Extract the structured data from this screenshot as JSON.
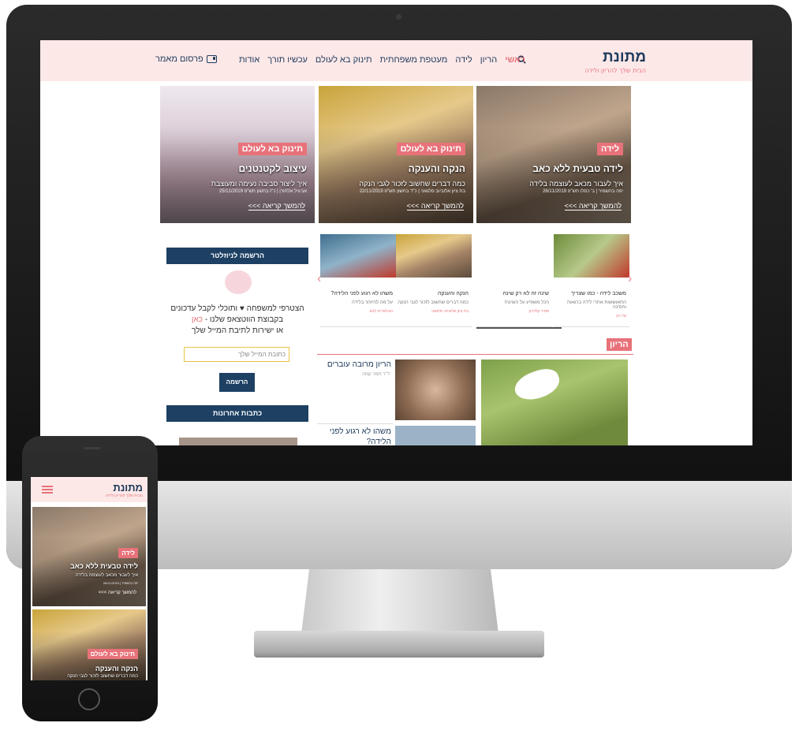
{
  "site": {
    "logo": "מתונת",
    "tagline": "הבית שלך להריון ולידה"
  },
  "nav": {
    "items": [
      "ראשי",
      "הריון",
      "לידה",
      "מעטפת משפחתית",
      "תינוק בא לעולם",
      "עכשיו תורך",
      "אודות"
    ],
    "publish": "פרסום מאמר"
  },
  "hero": [
    {
      "tag": "לידה",
      "title": "לידה טבעית ללא כאב",
      "subtitle": "איך לעבור מכאב לעוצמה בלידה",
      "meta": "יפה בהשמיר | ב' כסלו תש\"פ 26/11/2019",
      "more": "להמשך קריאה >>>"
    },
    {
      "tag": "תינוק בא לעולם",
      "title": "הנקה והענקה",
      "subtitle": "כמה דברים שחשוב לזכור לגבי הנקה",
      "meta": "בת ציון אלוביוב סלגאני | כ\"ד בחשון תש\"פ 22/11/2019",
      "more": "להמשך קריאה >>>"
    },
    {
      "tag": "תינוק בא לעולם",
      "title": "עיצוב לקטנטנים",
      "subtitle": "איך ליצור סביבה נעימה ומעוצבת",
      "meta": "אביגיל אלחורן | כ\"ז בחשון תש\"פ 25/11/2019",
      "more": "להמשך קריאה >>>"
    }
  ],
  "carousel": [
    {
      "title": "משכב לידה - כמו שצריך",
      "desc": "התאוששות אחרי לידה ברגאוה וחסינה",
      "author": "טל רון"
    },
    {
      "title": "שינה זה לא רק שינה",
      "desc": "הכל משפיע על השינה!",
      "author": "ספיר קלדרון"
    },
    {
      "title": "הנקה והענקה",
      "desc": "כמה דברים שחשוב לזכור לגבי הנקה",
      "author": "בת ציון אלוביוב סלגאני"
    },
    {
      "title": "משהו לא רגוע לפני הלידה?",
      "desc": "על מה להיזהר בלידה",
      "author": "הבולגרית לבא"
    }
  ],
  "newsletter": {
    "heading": "הרשמה לניוזלטר",
    "line1": "הצטרפי למשפחה ♥ ותוכלי לקבל עדכונים",
    "line2a": "בקבוצת הווטצאפ שלנו - ",
    "line2b": "כאן",
    "line3": "או ישירות לתיבת המייל שלך",
    "placeholder": "כתובת המייל שלך",
    "button": "הרשמה"
  },
  "recent": {
    "heading": "כתבות אחרונות"
  },
  "section": {
    "tag": "הריון",
    "article1_title": "הריון מרובה עוברים",
    "article1_author": "ד\"ר תמר קמה",
    "article2_title": "משהו לא רגוע לפני הלידה?"
  },
  "phone": {
    "cards": [
      {
        "tag": "לידה",
        "title": "לידה טבעית ללא כאב",
        "subtitle": "איך לעבור מכאב לעוצמה בלידה",
        "meta": "יפה בהשמיר | 26/11/2019",
        "more": "להמשך קריאה >>>"
      },
      {
        "tag": "תינוק בא לעולם",
        "title": "הנקה והענקה",
        "subtitle": "כמה דברים שחשוב לזכור לגבי הנקה"
      }
    ]
  },
  "colors": {
    "primary": "#1d4063",
    "accent": "#e8727a",
    "header_bg": "#fde8e8"
  }
}
